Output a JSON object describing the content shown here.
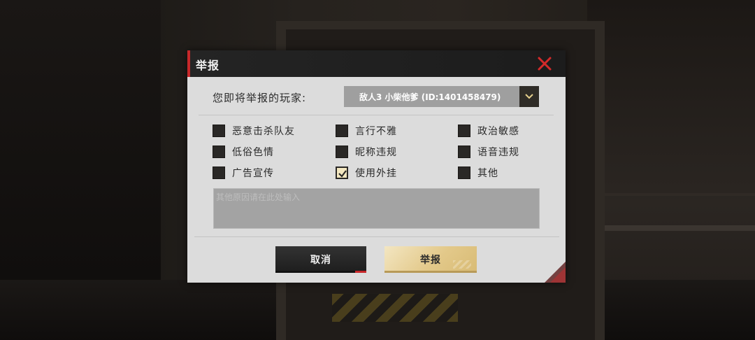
{
  "dialog": {
    "title": "举报",
    "player_label": "您即将举报的玩家:",
    "player_value": "敌人3    小柴他爹 (ID:1401458479)",
    "options": [
      {
        "label": "恶意击杀队友",
        "checked": false
      },
      {
        "label": "言行不雅",
        "checked": false
      },
      {
        "label": "政治敏感",
        "checked": false
      },
      {
        "label": "低俗色情",
        "checked": false
      },
      {
        "label": "昵称违规",
        "checked": false
      },
      {
        "label": "语音违规",
        "checked": false
      },
      {
        "label": "广告宣传",
        "checked": false
      },
      {
        "label": "使用外挂",
        "checked": true
      },
      {
        "label": "其他",
        "checked": false
      }
    ],
    "reason_placeholder": "其他原因请在此处输入",
    "reason_value": "",
    "cancel_label": "取消",
    "report_label": "举报"
  },
  "colors": {
    "accent_red": "#c8282a",
    "panel_bg": "#dcdcdc",
    "header_bg": "#242424",
    "gold": "#e3c98a"
  },
  "icons": {
    "close": "close-x-icon",
    "dropdown": "chevron-down-icon",
    "check": "check-icon"
  }
}
